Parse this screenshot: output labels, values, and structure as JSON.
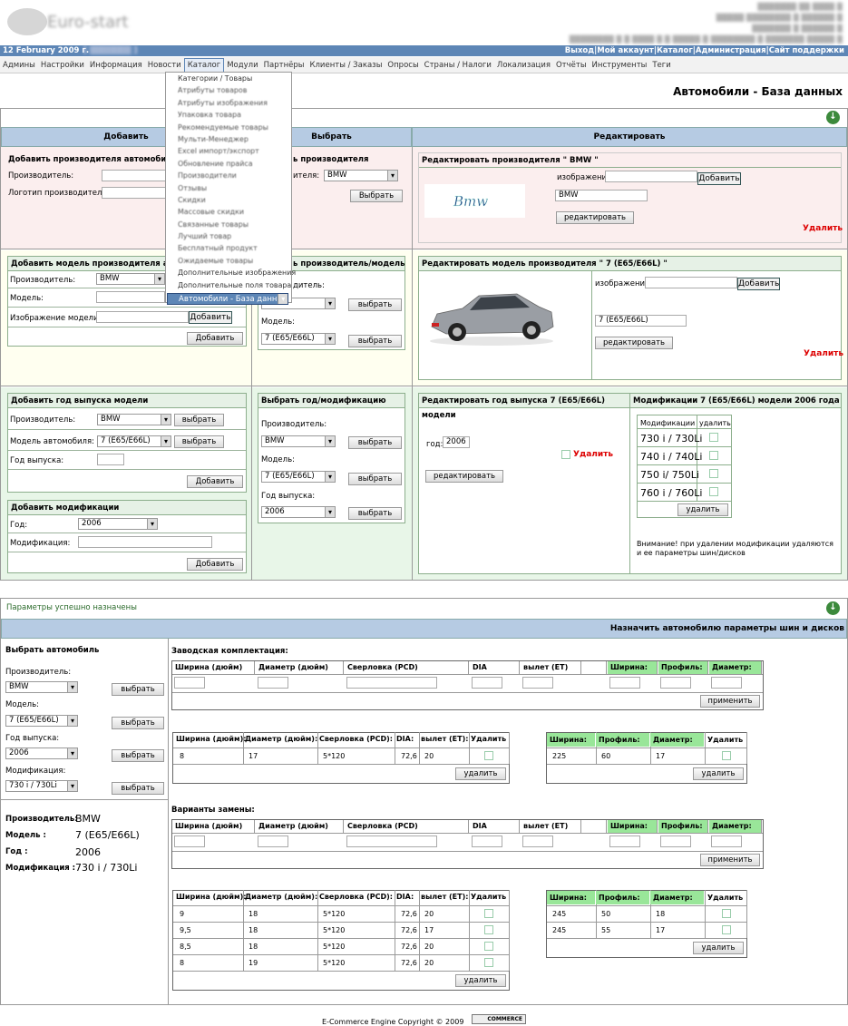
{
  "header": {
    "date": "12 February 2009 г.",
    "top_links": [
      "Выход",
      "Мой аккаунт",
      "Каталог",
      "Администрация",
      "Сайт поддержки"
    ]
  },
  "menu": [
    "Админы",
    "Настройки",
    "Информация",
    "Новости",
    "Каталог",
    "Модули",
    "Партнёры",
    "Клиенты / Заказы",
    "Опросы",
    "Страны / Налоги",
    "Локализация",
    "Отчёты",
    "Инструменты",
    "Теги"
  ],
  "dropdown": [
    "Категории / Товары",
    "Атрибуты товаров",
    "Атрибуты изображения",
    "Упаковка товара",
    "Рекомендуемые товары",
    "Мульти-Менеджер",
    "Excel импорт/экспорт",
    "Обновление прайса",
    "Производители",
    "Отзывы",
    "Скидки",
    "Массовые скидки",
    "Связанные товары",
    "Лучший товар",
    "Бесплатный продукт",
    "Ожидаемые товары",
    "Дополнительные изображения",
    "Дополнительные поля товара",
    "Автомобили - База данных"
  ],
  "page_title": "Автомобили - База данных",
  "cols": {
    "add": "Добавить",
    "select": "Выбрать",
    "edit": "Редактировать"
  },
  "add_maker": {
    "title": "Добавить производителя автомобилей",
    "maker_lbl": "Производитель:",
    "logo_lbl": "Логотип производителя:"
  },
  "sel_maker": {
    "title": "ь производителя",
    "maker_lbl": "ителя:",
    "value": "BMW",
    "btn": "Выбрать"
  },
  "edit_maker": {
    "title": "Редактировать производителя \" BMW \"",
    "img_lbl": "изображение:",
    "add_btn": "Добавить",
    "value": "BMW",
    "btn": "редактировать",
    "delete": "Удалить",
    "logo_text": "Bmw"
  },
  "add_model": {
    "title": "Добавить модель производителя авто",
    "maker_lbl": "Производитель:",
    "maker": "BMW",
    "model_lbl": "Модель:",
    "img_lbl": "Изображение модели:",
    "add_btn": "Добавить",
    "btn": "Добавить"
  },
  "sel_model": {
    "title": "ь производитель/модель",
    "lbl1": "дитель:",
    "v1": "BMW",
    "btn1": "выбрать",
    "lbl2": "Модель:",
    "v2": "7 (E65/E66L)",
    "btn2": "выбрать"
  },
  "edit_model": {
    "title": "Редактировать модель производителя \" 7 (E65/E66L) \"",
    "img_lbl": "изображение:",
    "add_btn": "Добавить",
    "value": "7 (E65/E66L)",
    "btn": "редактировать",
    "delete": "Удалить"
  },
  "add_year": {
    "title": "Добавить год выпуска модели",
    "maker_lbl": "Производитель:",
    "maker": "BMW",
    "btn1": "выбрать",
    "model_lbl": "Модель автомобиля:",
    "model": "7 (E65/E66L)",
    "btn2": "выбрать",
    "year_lbl": "Год выпуска:",
    "btn": "Добавить"
  },
  "add_mod": {
    "title": "Добавить модификации",
    "year_lbl": "Год:",
    "year": "2006",
    "mod_lbl": "Модификация:",
    "btn": "Добавить"
  },
  "sel_year": {
    "title": "Выбрать год/модификацию",
    "maker_lbl": "Производитель:",
    "maker": "BMW",
    "btn1": "выбрать",
    "model_lbl": "Модель:",
    "model": "7 (E65/E66L)",
    "btn2": "выбрать",
    "year_lbl": "Год выпуска:",
    "year": "2006",
    "btn3": "выбрать"
  },
  "edit_year": {
    "title": "Редактировать год выпуска 7 (E65/E66L) модели",
    "year_lbl": "год:",
    "year": "2006",
    "delete": "Удалить",
    "btn": "редактировать"
  },
  "mods": {
    "title": "Модификации 7 (E65/E66L) модели 2006 года",
    "h1": "Модификации",
    "h2": "удалить",
    "items": [
      "730 i / 730Li",
      "740 i / 740Li",
      "750 i/ 750Li",
      "760 i / 760Li"
    ],
    "btn": "удалить",
    "note": "Внимание! при удалении модификации удаляются и ее параметры шин/дисков"
  },
  "status": "Параметры успешно назначены",
  "assign_title": "Назначить автомобилю параметры шин и дисков",
  "choose": {
    "title": "Выбрать автомобиль",
    "maker_lbl": "Производитель:",
    "maker": "BMW",
    "model_lbl": "Модель:",
    "model": "7 (E65/E66L)",
    "year_lbl": "Год выпуска:",
    "year": "2006",
    "mod_lbl": "Модификация:",
    "mod": "730 i / 730Li",
    "btn": "выбрать"
  },
  "summary": {
    "maker_lbl": "Производитель:",
    "maker": "BMW",
    "model_lbl": "Модель :",
    "model": "7 (E65/E66L)",
    "year_lbl": "Год :",
    "year": "2006",
    "mod_lbl": "Модификация :",
    "mod": "730 i / 730Li"
  },
  "factory": {
    "title": "Заводская комплектация:",
    "heads": [
      "Ширина (дюйм)",
      "Диаметр (дюйм)",
      "Сверловка (PCD)",
      "DIA",
      "вылет (ET)",
      "Ширина:",
      "Профиль:",
      "Диаметр:"
    ],
    "apply": "применить"
  },
  "disc_heads": [
    "Ширина (дюйм):",
    "Диаметр (дюйм):",
    "Сверловка (PCD):",
    "DIA:",
    "вылет (ET):",
    "Удалить"
  ],
  "tire_heads": [
    "Ширина:",
    "Профиль:",
    "Диаметр:",
    "Удалить"
  ],
  "factory_discs": [
    [
      "8",
      "17",
      "5*120",
      "72,6",
      "20"
    ]
  ],
  "factory_tires": [
    [
      "225",
      "60",
      "17"
    ]
  ],
  "delete_btn": "удалить",
  "variants": {
    "title": "Варианты замены:"
  },
  "variant_discs": [
    [
      "9",
      "18",
      "5*120",
      "72,6",
      "20"
    ],
    [
      "9,5",
      "18",
      "5*120",
      "72,6",
      "17"
    ],
    [
      "8,5",
      "18",
      "5*120",
      "72,6",
      "20"
    ],
    [
      "8",
      "19",
      "5*120",
      "72,6",
      "20"
    ]
  ],
  "variant_tires": [
    [
      "245",
      "50",
      "18"
    ],
    [
      "245",
      "55",
      "17"
    ]
  ],
  "footer": "E-Commerce Engine Copyright © 2009",
  "footer_badge": "COMMERCE"
}
